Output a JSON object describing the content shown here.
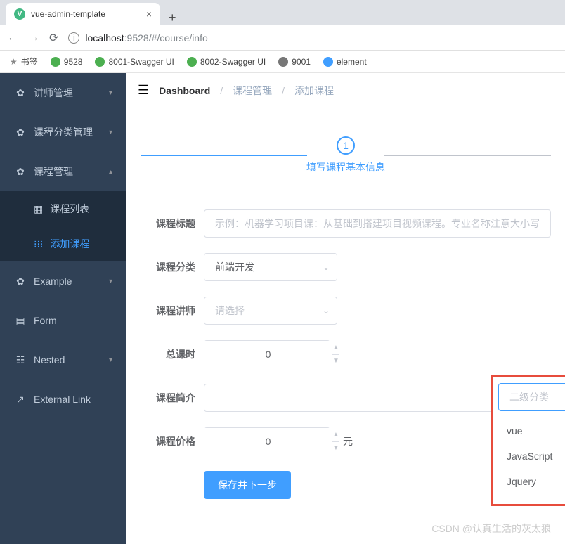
{
  "browser": {
    "tab_title": "vue-admin-template",
    "url_host": "localhost",
    "url_port": ":9528",
    "url_path": "/#/course/info",
    "bookmarks": {
      "label": "书签",
      "items": [
        "9528",
        "8001-Swagger UI",
        "8002-Swagger UI",
        "9001",
        "element"
      ]
    }
  },
  "sidebar": {
    "items": [
      {
        "label": "讲师管理",
        "expanded": false
      },
      {
        "label": "课程分类管理",
        "expanded": false
      },
      {
        "label": "课程管理",
        "expanded": true,
        "children": [
          {
            "label": "课程列表",
            "active": false
          },
          {
            "label": "添加课程",
            "active": true
          }
        ]
      },
      {
        "label": "Example",
        "expanded": false
      },
      {
        "label": "Form",
        "expanded": false
      },
      {
        "label": "Nested",
        "expanded": false
      },
      {
        "label": "External Link",
        "expanded": false
      }
    ]
  },
  "breadcrumb": {
    "items": [
      "Dashboard",
      "课程管理",
      "添加课程"
    ]
  },
  "steps": {
    "current": "1",
    "title": "填写课程基本信息"
  },
  "form": {
    "title_label": "课程标题",
    "title_placeholder": "示例：机器学习项目课：从基础到搭建项目视频课程。专业名称注意大小写",
    "category_label": "课程分类",
    "category_value": "前端开发",
    "subcategory_placeholder": "二级分类",
    "teacher_label": "课程讲师",
    "teacher_placeholder": "请选择",
    "lesson_label": "总课时",
    "lesson_value": "0",
    "desc_label": "课程简介",
    "price_label": "课程价格",
    "price_value": "0",
    "price_unit": "元",
    "submit": "保存并下一步"
  },
  "dropdown": {
    "options": [
      "vue",
      "JavaScript",
      "Jquery"
    ]
  },
  "watermark": "CSDN @认真生活的灰太狼"
}
